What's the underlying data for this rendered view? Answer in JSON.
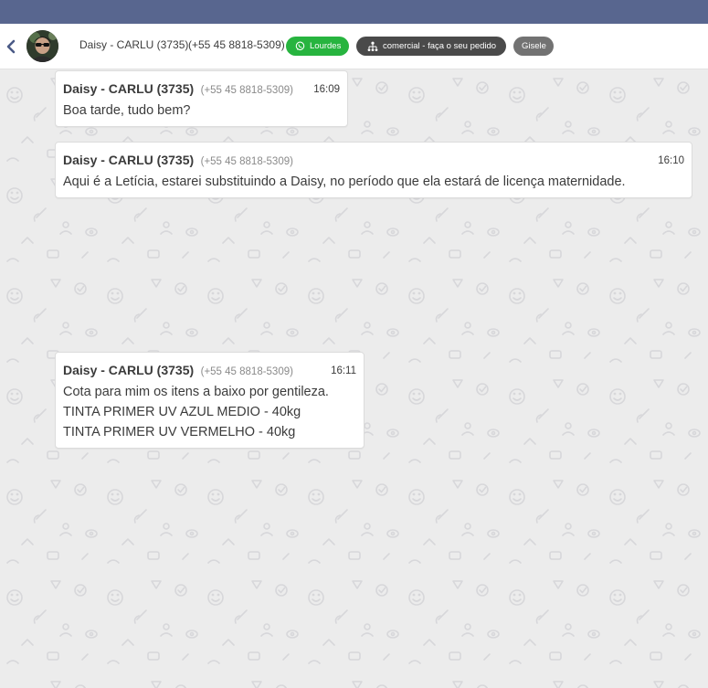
{
  "header": {
    "contact_name": "Daisy - CARLU (3735)",
    "contact_phone": "(+55 45 8818-5309)",
    "tags": {
      "connection": "Lourdes",
      "queue": "comercial - faça o seu pedido",
      "user": "Gisele"
    }
  },
  "colors": {
    "topbar": "#58668f",
    "whatsapp_tag": "#27b43f",
    "queue_tag": "#4a4a4a",
    "user_tag": "#727272",
    "chat_background": "#ececec"
  },
  "icons": {
    "back": "chevron-left-icon",
    "connection": "whatsapp-icon",
    "queue": "org-tree-icon"
  },
  "messages": [
    {
      "sender": "Daisy - CARLU (3735)",
      "phone": "(+55 45 8818-5309)",
      "time": "16:09",
      "lines": [
        "Boa tarde, tudo bem?"
      ]
    },
    {
      "sender": "Daisy - CARLU (3735)",
      "phone": "(+55 45 8818-5309)",
      "time": "16:10",
      "lines": [
        "Aqui é a Letícia, estarei substituindo a Daisy, no período que ela estará de licença maternidade."
      ]
    },
    {
      "sender": "Daisy - CARLU (3735)",
      "phone": "(+55 45 8818-5309)",
      "time": "16:11",
      "lines": [
        "Cota para mim os itens a baixo por gentileza.",
        "TINTA PRIMER UV AZUL MEDIO - 40kg",
        "TINTA PRIMER UV VERMELHO - 40kg"
      ]
    }
  ]
}
